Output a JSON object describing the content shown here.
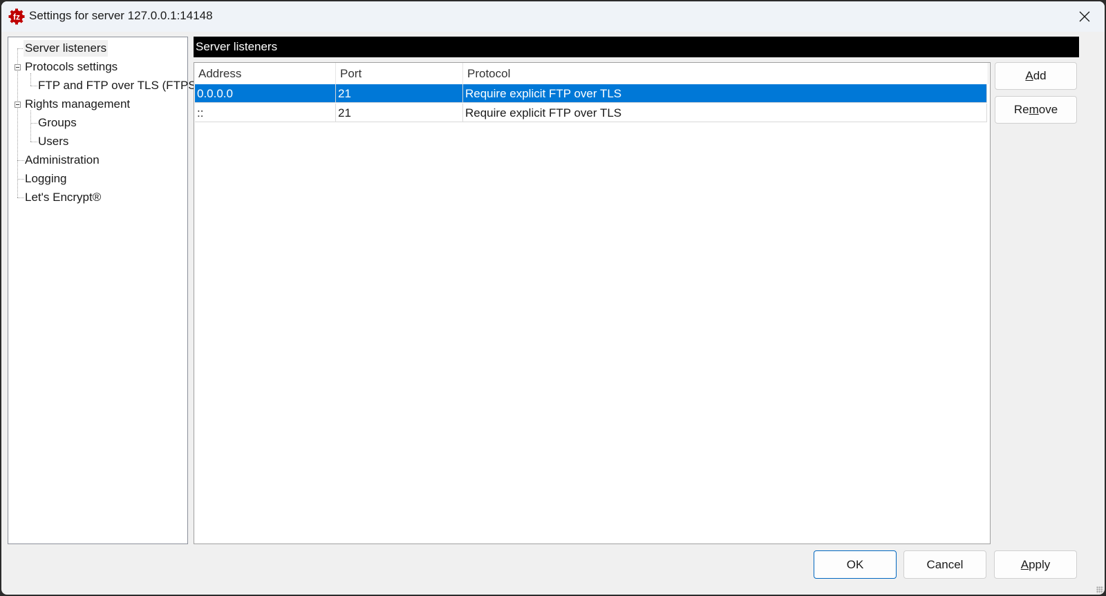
{
  "window": {
    "title": "Settings for server 127.0.0.1:14148",
    "app_icon": "filezilla-server-icon",
    "close_icon": "close-icon"
  },
  "tree": {
    "items": [
      {
        "label": "Server listeners",
        "level": 0,
        "selected": true
      },
      {
        "label": "Protocols settings",
        "level": 0,
        "expanded": true
      },
      {
        "label": "FTP and FTP over TLS (FTPS)",
        "level": 1
      },
      {
        "label": "Rights management",
        "level": 0,
        "expanded": true
      },
      {
        "label": "Groups",
        "level": 1
      },
      {
        "label": "Users",
        "level": 1
      },
      {
        "label": "Administration",
        "level": 0
      },
      {
        "label": "Logging",
        "level": 0
      },
      {
        "label": "Let's Encrypt®",
        "level": 0
      }
    ]
  },
  "panel": {
    "title": "Server listeners",
    "columns": [
      "Address",
      "Port",
      "Protocol"
    ],
    "rows": [
      {
        "address": "0.0.0.0",
        "port": "21",
        "protocol": "Require explicit FTP over TLS",
        "selected": true
      },
      {
        "address": "::",
        "port": "21",
        "protocol": "Require explicit FTP over TLS",
        "selected": false
      }
    ],
    "add": {
      "mnemonic": "A",
      "rest": "dd"
    },
    "remove": {
      "pre": "Re",
      "mnemonic": "m",
      "rest": "ove"
    }
  },
  "footer": {
    "ok": "OK",
    "cancel": "Cancel",
    "apply": {
      "mnemonic": "A",
      "rest": "pply"
    }
  },
  "colors": {
    "selection": "#0078d7",
    "header_bar": "#000000",
    "default_button_border": "#0067c0"
  }
}
